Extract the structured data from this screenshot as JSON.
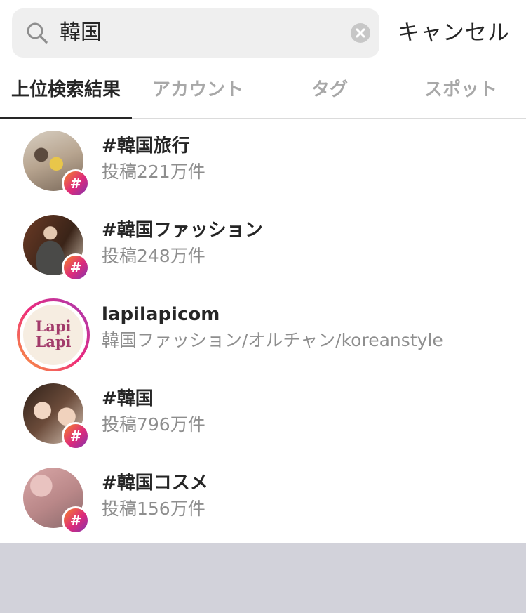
{
  "search": {
    "query": "韓国",
    "cancel_label": "キャンセル"
  },
  "tabs": [
    {
      "label": "上位検索結果",
      "active": true
    },
    {
      "label": "アカウント",
      "active": false
    },
    {
      "label": "タグ",
      "active": false
    },
    {
      "label": "スポット",
      "active": false
    }
  ],
  "results": [
    {
      "type": "hashtag",
      "title": "#韓国旅行",
      "subtitle": "投稿221万件",
      "badge": "#"
    },
    {
      "type": "hashtag",
      "title": "#韓国ファッション",
      "subtitle": "投稿248万件",
      "badge": "#"
    },
    {
      "type": "account",
      "title": "lapilapicom",
      "subtitle": "韓国ファッション/オルチャン/koreanstyle",
      "logo_line1": "Lapi",
      "logo_line2": "Lapi"
    },
    {
      "type": "hashtag",
      "title": "#韓国",
      "subtitle": "投稿796万件",
      "badge": "#"
    },
    {
      "type": "hashtag",
      "title": "#韓国コスメ",
      "subtitle": "投稿156万件",
      "badge": "#"
    }
  ],
  "colors": {
    "accent_gradient": [
      "#f58529",
      "#dd2a7b",
      "#8134af"
    ],
    "text_primary": "#262626",
    "text_secondary": "#8e8e8e",
    "tab_inactive": "#a8a8a8"
  }
}
